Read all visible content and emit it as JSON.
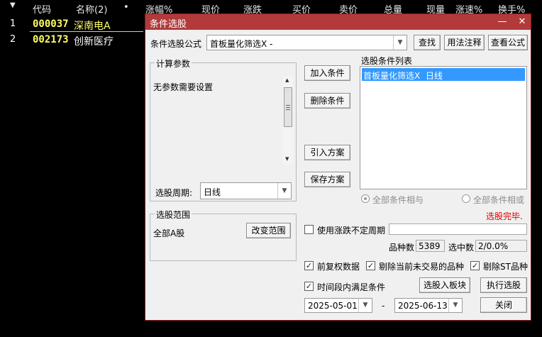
{
  "quote_table": {
    "headers": [
      "代码",
      "名称(2)",
      "•",
      "涨幅%",
      "现价",
      "涨跌",
      "买价",
      "卖价",
      "总量",
      "现量",
      "涨速%",
      "换手%"
    ],
    "rows": [
      {
        "index": "1",
        "code": "000037",
        "name": "深南电A"
      },
      {
        "index": "2",
        "code": "002173",
        "name": "创新医疗"
      }
    ]
  },
  "dialog": {
    "title": "条件选股",
    "close_glyph": "✕",
    "minimize_glyph": "—",
    "formula_label": "条件选股公式",
    "formula_value": "首板量化筛选X -",
    "find_button": "查找",
    "usage_button": "用法注释",
    "view_formula_button": "查看公式",
    "params_group": "计算参数",
    "params_text": "无参数需要设置",
    "add_condition": "加入条件",
    "delete_condition": "删除条件",
    "import_plan": "引入方案",
    "save_plan": "保存方案",
    "condition_list_label": "选股条件列表",
    "condition_list": [
      "首板量化筛选X  日线"
    ],
    "radio_and": "全部条件相与",
    "radio_or": "全部条件相或",
    "status_text": "选股完毕.",
    "period_label": "选股周期:",
    "period_value": "日线",
    "scope_group": "选股范围",
    "scope_value": "全部A股",
    "change_scope": "改变范围",
    "use_uncertain_label": "使用涨跌不定周期",
    "varieties_label": "品种数",
    "varieties_value": "5389",
    "selected_label": "选中数",
    "selected_value": "2/0.0%",
    "chk_fq_label": "前复权数据",
    "chk_remove_untraded_label": "剔除当前未交易的品种",
    "chk_remove_st_label": "剔除ST品种",
    "chk_period_label": "时间段内满足条件",
    "to_block_button": "选股入板块",
    "execute_button": "执行选股",
    "date_from": "2025-05-01",
    "date_sep": "-",
    "date_to": "2025-06-13",
    "close_button": "关闭",
    "checkmark": "✓",
    "accent_title_color": "#b23a3a",
    "status_color": "#e00000",
    "selection_color": "#3399ff"
  }
}
